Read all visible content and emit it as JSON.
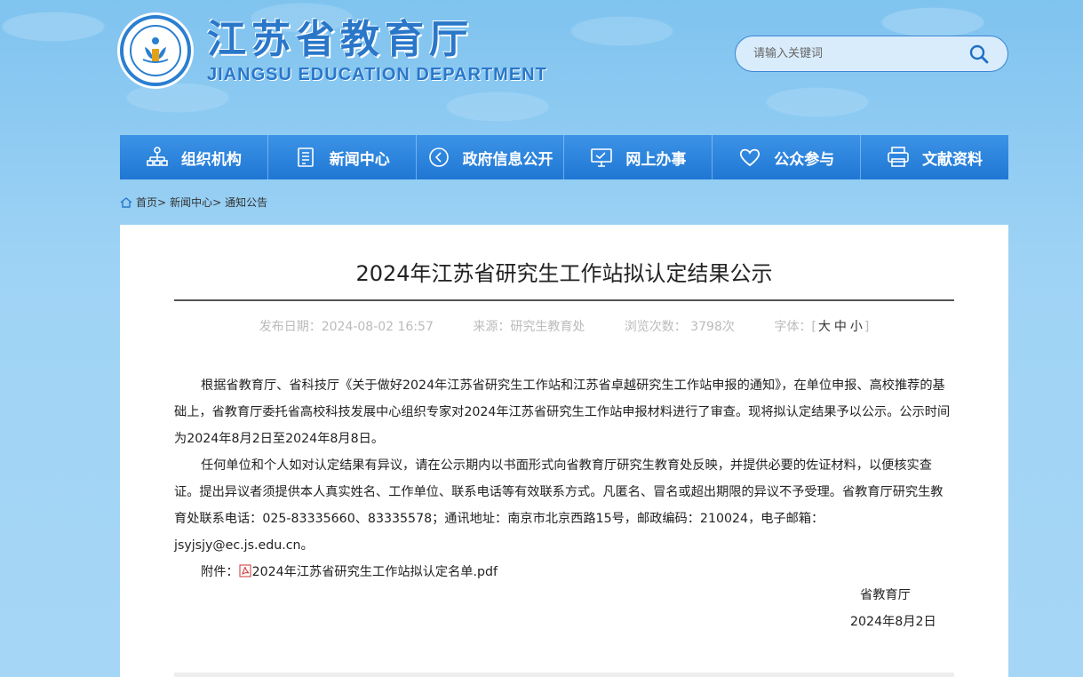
{
  "header": {
    "title_cn": "江苏省教育厅",
    "title_en": "JIANGSU EDUCATION DEPARTMENT",
    "search_placeholder": "请输入关键词"
  },
  "nav": [
    {
      "label": "组织机构",
      "icon": "org-chart-icon"
    },
    {
      "label": "新闻中心",
      "icon": "document-icon"
    },
    {
      "label": "政府信息公开",
      "icon": "arrow-circle-icon"
    },
    {
      "label": "网上办事",
      "icon": "monitor-icon"
    },
    {
      "label": "公众参与",
      "icon": "heart-icon"
    },
    {
      "label": "文献资料",
      "icon": "printer-icon"
    }
  ],
  "breadcrumb": {
    "home": "首页",
    "sep1": ">",
    "news": "新闻中心",
    "sep2": ">",
    "notice": "通知公告"
  },
  "article": {
    "title": "2024年江苏省研究生工作站拟认定结果公示",
    "meta": {
      "date": "发布日期：2024-08-02 16:57",
      "source": "来源：研究生教育处",
      "views": "浏览次数： 3798次",
      "font_label": "字体：",
      "font_open": "[",
      "font_large": "大",
      "font_medium": "中",
      "font_small": "小",
      "font_close": "]"
    },
    "paragraph1": "根据省教育厅、省科技厅《关于做好2024年江苏省研究生工作站和江苏省卓越研究生工作站申报的通知》，在单位申报、高校推荐的基础上，省教育厅委托省高校科技发展中心组织专家对2024年江苏省研究生工作站申报材料进行了审查。现将拟认定结果予以公示。公示时间为2024年8月2日至2024年8月8日。",
    "paragraph2": "任何单位和个人如对认定结果有异议，请在公示期内以书面形式向省教育厅研究生教育处反映，并提供必要的佐证材料，以便核实查证。提出异议者须提供本人真实姓名、工作单位、联系电话等有效联系方式。凡匿名、冒名或超出期限的异议不予受理。省教育厅研究生教育处联系电话：025-83335660、83335578；通讯地址：南京市北京西路15号，邮政编码：210024，电子邮箱：jsyjsjy@ec.js.edu.cn。",
    "attachment_label": "附件：",
    "attachment_file": "2024年江苏省研究生工作站拟认定名单.pdf",
    "signer": "省教育厅",
    "sign_date": "2024年8月2日"
  },
  "colors": {
    "nav_bg": "#2a83db",
    "brand": "#2a77c9"
  }
}
